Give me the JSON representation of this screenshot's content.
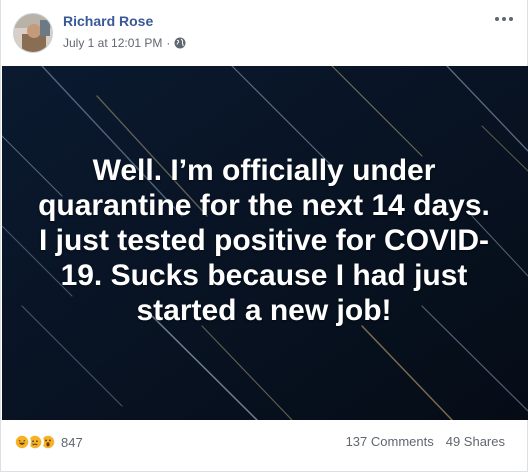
{
  "post": {
    "author": "Richard Rose",
    "timestamp": "July 1 at 12:01 PM",
    "separator": "·",
    "privacy_icon": "globe-icon",
    "more_icon": "more-options-icon",
    "text_lines": [
      "Well. I’m officially under",
      "quarantine for the next 14 days.",
      "I just tested positive for COVID-",
      "19. Sucks because I had just",
      "started a new job!"
    ],
    "background_color": "#071220"
  },
  "footer": {
    "reactions": [
      {
        "name": "haha-reaction-icon",
        "color": "#f7b125"
      },
      {
        "name": "sad-reaction-icon",
        "color": "#f7b125"
      },
      {
        "name": "wow-reaction-icon",
        "color": "#f7b125"
      }
    ],
    "reaction_count": "847",
    "comments": "137 Comments",
    "shares": "49 Shares"
  },
  "colors": {
    "author_link": "#385898",
    "meta_text": "#616770"
  }
}
